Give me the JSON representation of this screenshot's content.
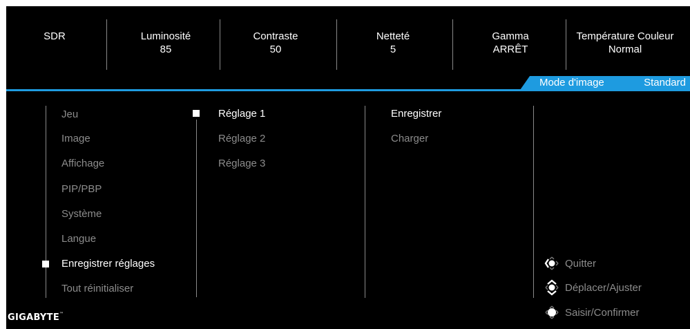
{
  "status": {
    "sdr": "SDR",
    "brightness": {
      "label": "Luminosité",
      "value": "85"
    },
    "contrast": {
      "label": "Contraste",
      "value": "50"
    },
    "sharpness": {
      "label": "Netteté",
      "value": "5"
    },
    "gamma": {
      "label": "Gamma",
      "value": "ARRÊT"
    },
    "color_temp": {
      "label": "Température Couleur",
      "value": "Normal"
    }
  },
  "mode": {
    "label": "Mode d'image",
    "value": "Standard"
  },
  "menu": {
    "items": [
      "Jeu",
      "Image",
      "Affichage",
      "PIP/PBP",
      "Système",
      "Langue",
      "Enregistrer réglages",
      "Tout réinitialiser"
    ],
    "selected": "Enregistrer réglages"
  },
  "submenu": {
    "items": [
      "Réglage 1",
      "Réglage 2",
      "Réglage 3"
    ],
    "selected": "Réglage 1"
  },
  "actions": {
    "items": [
      "Enregistrer",
      "Charger"
    ],
    "selected": "Enregistrer"
  },
  "hints": [
    {
      "icon": "joystick-left-icon",
      "label": "Quitter"
    },
    {
      "icon": "joystick-updown-icon",
      "label": "Déplacer/Ajuster"
    },
    {
      "icon": "joystick-press-icon",
      "label": "Saisir/Confirmer"
    }
  ],
  "brand": {
    "logo": "GIGABYTE",
    "trademark": "™"
  },
  "colors": {
    "accent": "#1e9be0",
    "background": "#000000",
    "dim_text": "#8c8c8c"
  }
}
